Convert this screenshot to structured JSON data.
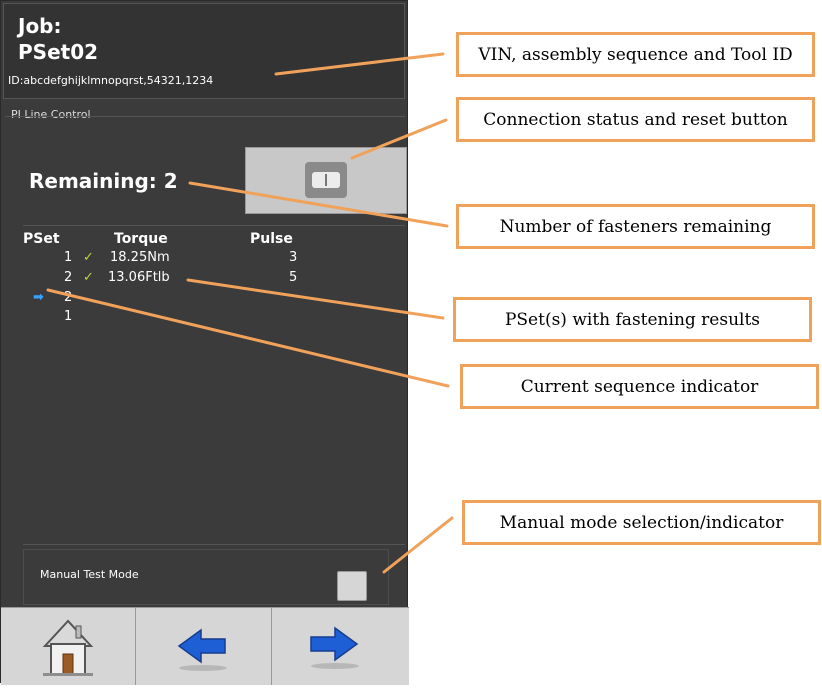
{
  "header": {
    "job_label": "Job:",
    "pset_name": "PSet02",
    "id_line": "ID:abcdefghijklmnopqrst,54321,1234"
  },
  "group": {
    "title": "PI Line Control"
  },
  "status": {
    "remaining_text": "Remaining: 2",
    "reset_icon": "plug-icon"
  },
  "results": {
    "columns": [
      "PSet",
      "Torque",
      "Pulse"
    ],
    "rows": [
      {
        "pset": "1",
        "torque": "18.25Nm",
        "pulse": "3",
        "ok": true
      },
      {
        "pset": "2",
        "torque": "13.06Ftlb",
        "pulse": "5",
        "ok": true
      },
      {
        "pset": "2",
        "torque": "",
        "pulse": "",
        "ok": false,
        "current": true
      },
      {
        "pset": "1",
        "torque": "",
        "pulse": "",
        "ok": false
      }
    ],
    "check_glyph": "✓",
    "current_glyph": "➡"
  },
  "manual": {
    "label": "Manual Test Mode",
    "checked": false
  },
  "nav": {
    "home_icon": "house-icon",
    "back_icon": "arrow-left-icon",
    "forward_icon": "arrow-right-icon"
  },
  "colors": {
    "panel_bg": "#3b3b3b",
    "callout_border": "#f0a15a",
    "check": "#b8d63a",
    "arrow_blue": "#1f5fd6"
  },
  "callouts": [
    "VIN, assembly sequence and Tool ID",
    "Connection status and reset button",
    "Number of fasteners remaining",
    "PSet(s) with fastening results",
    "Current sequence indicator",
    "Manual mode selection/indicator"
  ]
}
